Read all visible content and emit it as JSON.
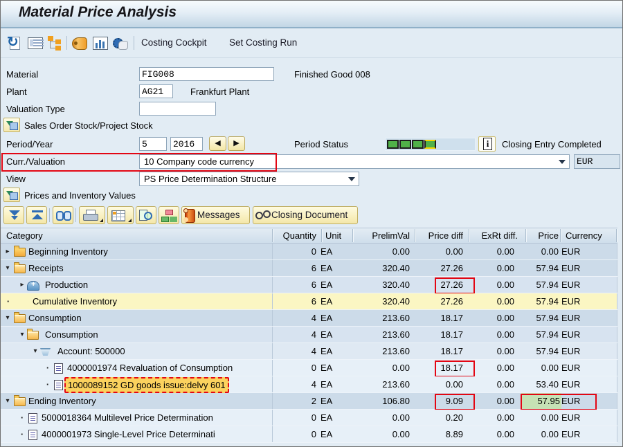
{
  "colors": {
    "annotation_red": "#e30613",
    "highlight_yellow": "#fbd25e",
    "highlight_green": "#c6e2b5",
    "status_segment_green": "#50b148"
  },
  "window": {
    "title": "Material Price Analysis"
  },
  "toolbar": {
    "icons": [
      "refresh-icon",
      "detail-list-icon",
      "hierarchy-icon",
      "drum-icon",
      "column-chart-icon",
      "grab-hand-gear-icon"
    ],
    "buttons": [
      {
        "label": "Costing Cockpit"
      },
      {
        "label": "Set Costing Run"
      }
    ]
  },
  "form": {
    "material": {
      "label": "Material",
      "value": "FIG008",
      "description": "Finished Good 008"
    },
    "plant": {
      "label": "Plant",
      "value": "AG21",
      "description": "Frankfurt Plant"
    },
    "valuation_type": {
      "label": "Valuation Type",
      "value": ""
    },
    "sales_order_section_title": "Sales Order Stock/Project Stock",
    "period": {
      "label": "Period/Year",
      "month": "5",
      "year": "2016"
    },
    "period_status": {
      "label": "Period Status",
      "filled_segments": 4,
      "status_text": "Closing Entry Completed"
    },
    "currency_valuation": {
      "label": "Curr./Valuation",
      "value": "10 Company code currency",
      "currency": "EUR"
    },
    "view": {
      "label": "View",
      "value": "PS Price Determination Structure"
    }
  },
  "inventory_section": {
    "title": "Prices and Inventory Values",
    "toolbar_icons": [
      "expand-all-icon",
      "collapse-all-icon",
      "find-icon",
      "print-icon",
      "export-grid-icon",
      "detail-display-icon",
      "org-hierarchy-icon"
    ],
    "messages_label": "Messages",
    "closing_document_label": "Closing Document"
  },
  "table": {
    "columns": [
      "Category",
      "Quantity",
      "Unit",
      "PrelimVal",
      "Price diff",
      "ExRt diff.",
      "Price",
      "Currency"
    ],
    "rows": [
      {
        "category": "Beginning Inventory",
        "quantity": "0",
        "unit": "EA",
        "prelim_val": "0.00",
        "price_diff": "0.00",
        "exrt_diff": "0.00",
        "price": "0.00",
        "currency": "EUR"
      },
      {
        "category": "Receipts",
        "quantity": "6",
        "unit": "EA",
        "prelim_val": "320.40",
        "price_diff": "27.26",
        "exrt_diff": "0.00",
        "price": "57.94",
        "currency": "EUR"
      },
      {
        "category": "Production",
        "quantity": "6",
        "unit": "EA",
        "prelim_val": "320.40",
        "price_diff": "27.26",
        "exrt_diff": "0.00",
        "price": "57.94",
        "currency": "EUR",
        "annotation": "red-box-price-diff"
      },
      {
        "category": "Cumulative Inventory",
        "quantity": "6",
        "unit": "EA",
        "prelim_val": "320.40",
        "price_diff": "27.26",
        "exrt_diff": "0.00",
        "price": "57.94",
        "currency": "EUR"
      },
      {
        "category": "Consumption",
        "quantity": "4",
        "unit": "EA",
        "prelim_val": "213.60",
        "price_diff": "18.17",
        "exrt_diff": "0.00",
        "price": "57.94",
        "currency": "EUR"
      },
      {
        "category": "Consumption",
        "quantity": "4",
        "unit": "EA",
        "prelim_val": "213.60",
        "price_diff": "18.17",
        "exrt_diff": "0.00",
        "price": "57.94",
        "currency": "EUR"
      },
      {
        "category": "Account: 500000",
        "quantity": "4",
        "unit": "EA",
        "prelim_val": "213.60",
        "price_diff": "18.17",
        "exrt_diff": "0.00",
        "price": "57.94",
        "currency": "EUR"
      },
      {
        "category": "4000001974 Revaluation of Consumption",
        "quantity": "0",
        "unit": "EA",
        "prelim_val": "0.00",
        "price_diff": "18.17",
        "exrt_diff": "0.00",
        "price": "0.00",
        "currency": "EUR",
        "annotation": "red-box-price-diff"
      },
      {
        "category": "1000089152 GD goods issue:delvy 601",
        "quantity": "4",
        "unit": "EA",
        "prelim_val": "213.60",
        "price_diff": "0.00",
        "exrt_diff": "0.00",
        "price": "53.40",
        "currency": "EUR",
        "annotation": "yellow-highlight-category"
      },
      {
        "category": "Ending Inventory",
        "quantity": "2",
        "unit": "EA",
        "prelim_val": "106.80",
        "price_diff": "9.09",
        "exrt_diff": "0.00",
        "price": "57.95",
        "currency": "EUR",
        "annotation": "red-box-price-diff,red-box-price,green-highlight-price"
      },
      {
        "category": "5000018364 Multilevel Price Determination",
        "quantity": "0",
        "unit": "EA",
        "prelim_val": "0.00",
        "price_diff": "0.20",
        "exrt_diff": "0.00",
        "price": "0.00",
        "currency": "EUR"
      },
      {
        "category": "4000001973 Single-Level Price Determinati",
        "quantity": "0",
        "unit": "EA",
        "prelim_val": "0.00",
        "price_diff": "8.89",
        "exrt_diff": "0.00",
        "price": "0.00",
        "currency": "EUR"
      }
    ]
  }
}
